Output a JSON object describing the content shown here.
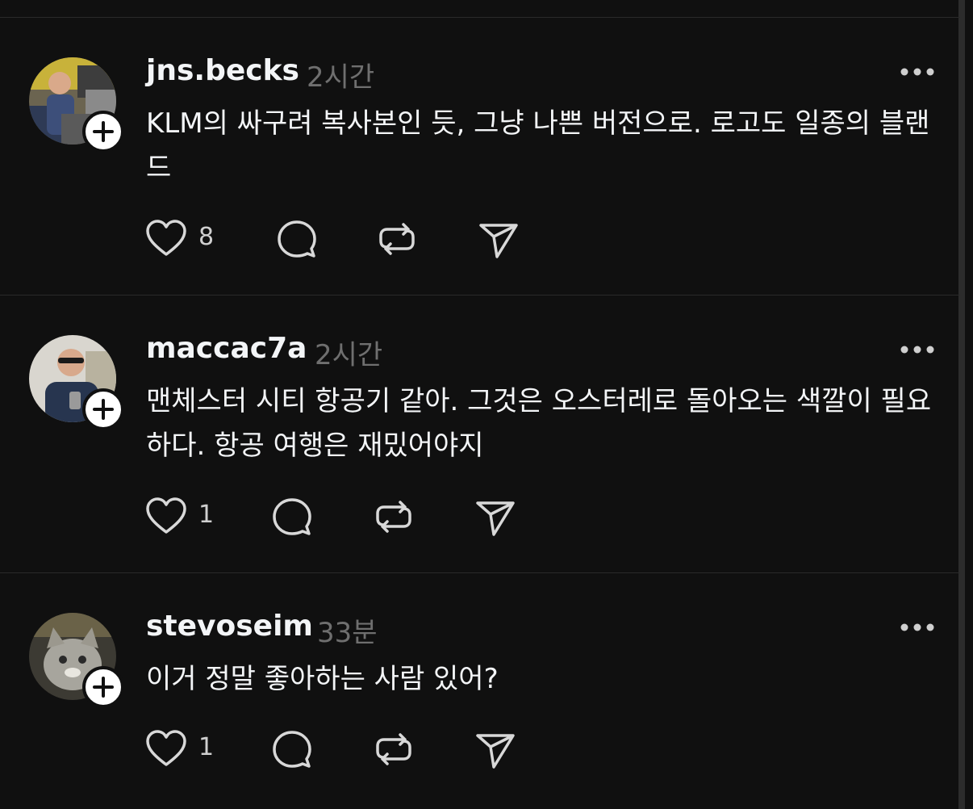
{
  "posts": [
    {
      "username": "jns.becks",
      "time": "2시간",
      "text": "KLM의 싸구려 복사본인 듯, 그냥 나쁜 버전으로. 로고도 일종의 블랜드",
      "likes": "8"
    },
    {
      "username": "maccac7a",
      "time": "2시간",
      "text": "맨체스터 시티 항공기 같아. 그것은 오스터레로 돌아오는 색깔이 필요하다. 항공 여행은 재밌어야지",
      "likes": "1"
    },
    {
      "username": "stevoseim",
      "time": "33분",
      "text": "이거 정말 좋아하는 사람 있어?",
      "likes": "1"
    }
  ],
  "icons": {
    "follow": "plus-icon",
    "more": "more-icon",
    "like": "heart-icon",
    "reply": "comment-icon",
    "repost": "repost-icon",
    "share": "send-icon"
  },
  "colors": {
    "background": "#101010",
    "text": "#f3f5f7",
    "muted": "#6f6f6f",
    "divider": "#2a2a2a"
  }
}
